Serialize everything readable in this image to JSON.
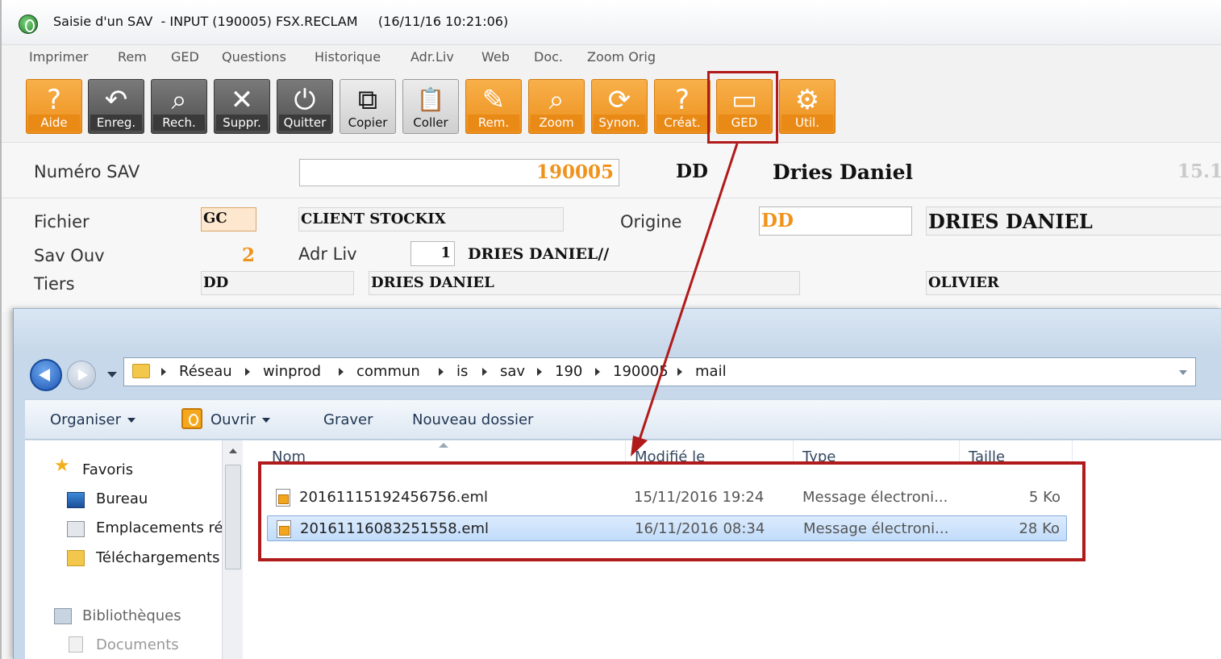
{
  "app": {
    "title": "Saisie d'un SAV  - INPUT (190005) FSX.RECLAM     (16/11/16 10:21:06)",
    "menu": [
      "Imprimer",
      "Rem",
      "GED",
      "Questions",
      "Historique",
      "Adr.Liv",
      "Web",
      "Doc.",
      "Zoom Orig"
    ],
    "toolbar": [
      {
        "label": "Aide",
        "icon": "question-icon",
        "glyph": "?"
      },
      {
        "label": "Enreg.",
        "icon": "undo-arrow-icon",
        "glyph": "↶"
      },
      {
        "label": "Rech.",
        "icon": "search-abc-icon",
        "glyph": "⌕"
      },
      {
        "label": "Suppr.",
        "icon": "delete-x-icon",
        "glyph": "✕"
      },
      {
        "label": "Quitter",
        "icon": "power-icon",
        "glyph": "⏻"
      },
      {
        "label": "Copier",
        "icon": "copy-icon",
        "glyph": "⧉"
      },
      {
        "label": "Coller",
        "icon": "paste-clipboard-icon",
        "glyph": "📋"
      },
      {
        "label": "Rem.",
        "icon": "pencil-icon",
        "glyph": "✎"
      },
      {
        "label": "Zoom",
        "icon": "magnifier-icon",
        "glyph": "⌕"
      },
      {
        "label": "Synon.",
        "icon": "refresh-icon",
        "glyph": "⟳"
      },
      {
        "label": "Créat.",
        "icon": "user-question-icon",
        "glyph": "?"
      },
      {
        "label": "GED",
        "icon": "folder-icon",
        "glyph": "▭"
      },
      {
        "label": "Util.",
        "icon": "gears-icon",
        "glyph": "⚙"
      }
    ],
    "form": {
      "numero_label": "Numéro SAV",
      "numero_value": "190005",
      "code": "DD",
      "client_name": "Dries Daniel",
      "partial_right": "15.1",
      "fichier_label": "Fichier",
      "fichier_value": "GC",
      "fichier_desc": "CLIENT STOCKIX",
      "origine_label": "Origine",
      "origine_value": "DD",
      "origine_name": "DRIES DANIEL",
      "savouv_label": "Sav Ouv",
      "savouv_value": "2",
      "adrliv_label": "Adr Liv",
      "adrliv_value": "1",
      "adrliv_name": "DRIES DANIEL//",
      "tiers_label": "Tiers",
      "tiers_code": "DD",
      "tiers_name": "DRIES DANIEL",
      "tiers_contact": "OLIVIER"
    }
  },
  "explorer": {
    "breadcrumbs": [
      "Réseau",
      "winprod",
      "commun",
      "is",
      "sav",
      "190",
      "190005",
      "mail"
    ],
    "commands": {
      "organiser": "Organiser",
      "ouvrir": "Ouvrir",
      "graver": "Graver",
      "nouveau_dossier": "Nouveau dossier"
    },
    "nav": {
      "favoris": "Favoris",
      "bureau": "Bureau",
      "emplacements": "Emplacements ré",
      "telechargements": "Téléchargements",
      "bibliotheques": "Bibliothèques",
      "documents": "Documents"
    },
    "columns": [
      "Nom",
      "Modifié le",
      "Type",
      "Taille"
    ],
    "files": [
      {
        "name": "20161115192456756.eml",
        "modified": "15/11/2016 19:24",
        "type": "Message électroni...",
        "size": "5 Ko",
        "selected": false
      },
      {
        "name": "20161116083251558.eml",
        "modified": "16/11/2016 08:34",
        "type": "Message électroni...",
        "size": "28 Ko",
        "selected": true
      }
    ]
  },
  "colors": {
    "toolbar_orange": "#ec8f1c",
    "highlight_red": "#b01a1a",
    "selection_blue": "#c1dcfb",
    "value_orange": "#f0921b"
  }
}
